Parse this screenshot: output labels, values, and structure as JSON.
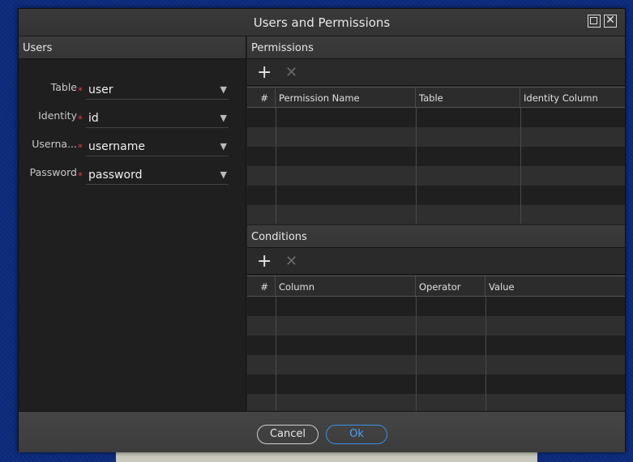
{
  "dialog": {
    "title": "Users and Permissions",
    "maximize_glyph": "",
    "close_glyph": "✕"
  },
  "users": {
    "header": "Users",
    "fields": [
      {
        "label": "Table",
        "value": "user"
      },
      {
        "label": "Identity",
        "value": "id"
      },
      {
        "label": "Userna...",
        "value": "username"
      },
      {
        "label": "Password",
        "value": "password"
      }
    ],
    "required_mark": "*",
    "arrow_glyph": "▼"
  },
  "permissions": {
    "header": "Permissions",
    "add_glyph": "+",
    "remove_glyph": "✕",
    "columns": [
      "#",
      "Permission Name",
      "Table",
      "Identity Column"
    ]
  },
  "conditions": {
    "header": "Conditions",
    "add_glyph": "+",
    "remove_glyph": "✕",
    "columns": [
      "#",
      "Column",
      "Operator",
      "Value"
    ]
  },
  "footer": {
    "cancel_label": "Cancel",
    "ok_label": "Ok"
  }
}
